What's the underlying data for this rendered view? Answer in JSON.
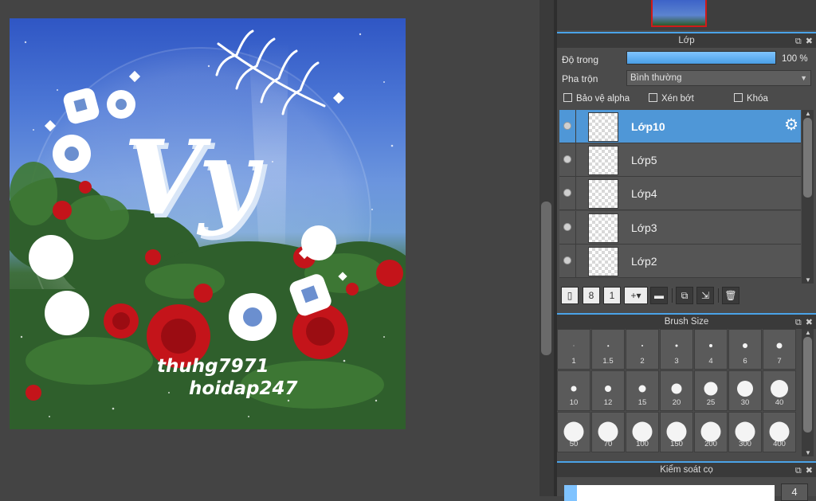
{
  "artwork": {
    "big_text": "Vy",
    "caption_line1": "thuhg7971",
    "caption_line2": "hoidap247"
  },
  "layer_panel": {
    "title": "Lớp",
    "opacity_label": "Độ trong",
    "opacity_value": "100 %",
    "opacity_level": 1.0,
    "blend_label": "Pha trộn",
    "blend_value": "Bình thường",
    "protect_alpha": "Bảo vệ alpha",
    "clipping": "Xén bớt",
    "lock": "Khóa",
    "layers": [
      {
        "name": "Lớp10",
        "selected": true
      },
      {
        "name": "Lớp5",
        "selected": false
      },
      {
        "name": "Lớp4",
        "selected": false
      },
      {
        "name": "Lớp3",
        "selected": false
      },
      {
        "name": "Lớp2",
        "selected": false
      }
    ],
    "toolbar_icons": [
      "new-layer-icon",
      "new-8bit-layer-icon",
      "new-1bit-layer-icon",
      "add-layer-menu-icon",
      "folder-icon",
      "duplicate-layer-icon",
      "merge-layer-icon",
      "delete-layer-icon"
    ]
  },
  "brush_panel": {
    "title": "Brush Size",
    "sizes": [
      "1",
      "1.5",
      "2",
      "3",
      "4",
      "6",
      "7",
      "10",
      "12",
      "15",
      "20",
      "25",
      "30",
      "40",
      "50",
      "70",
      "100",
      "150",
      "200",
      "300",
      "400"
    ]
  },
  "control_panel": {
    "title": "Kiểm soát cọ",
    "value": "4"
  },
  "colors": {
    "accent": "#4aa3e8",
    "selected_layer": "#4f97d7",
    "panel_bg": "#4b4b4b"
  }
}
